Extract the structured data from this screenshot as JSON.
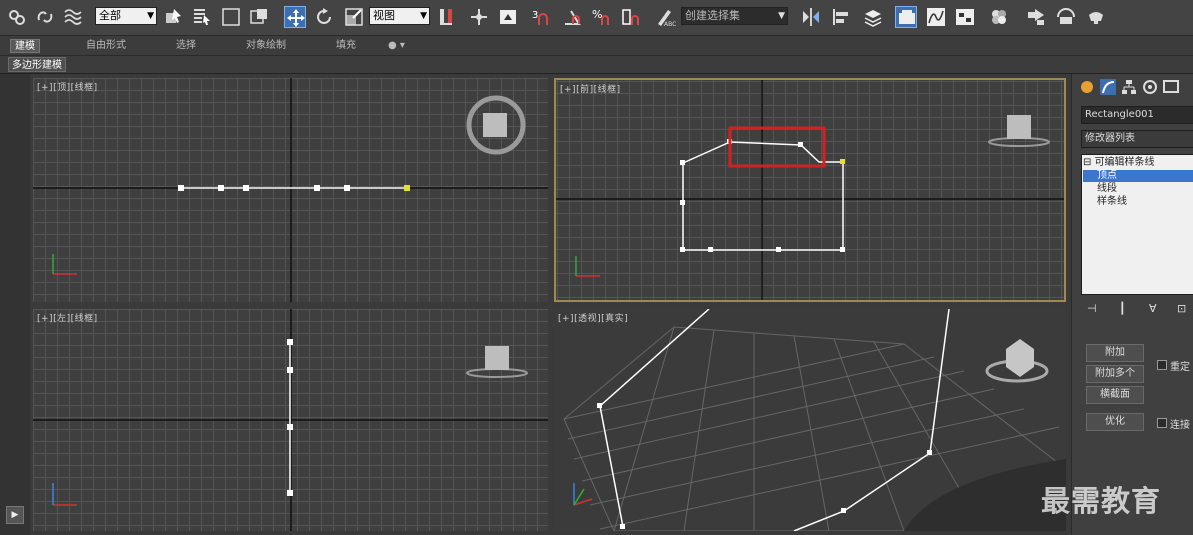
{
  "toolbar": {
    "selection_filter": "全部",
    "reference_coord": "视图",
    "named_selection_placeholder": "创建选择集",
    "snap_angle": "3",
    "icons": [
      "link-icon",
      "unlink-icon",
      "bind-spacewarp-icon",
      "select-object-icon",
      "select-by-name-icon",
      "rect-region-icon",
      "window-crossing-icon",
      "select-move-icon",
      "select-rotate-icon",
      "select-scale-icon",
      "pivot-icon",
      "select-manipulate-icon",
      "snap-toggle-icon",
      "angle-snap-icon",
      "percent-snap-icon",
      "spinner-snap-icon",
      "edit-named-sets-icon",
      "mirror-icon",
      "align-icon",
      "layer-manager-icon",
      "graphite-tools-icon",
      "curve-editor-icon",
      "schematic-view-icon",
      "material-editor-icon",
      "render-setup-icon",
      "rendered-frame-icon",
      "render-icon"
    ]
  },
  "ribbon": {
    "tabs": [
      "建模",
      "自由形式",
      "选择",
      "对象绘制",
      "填充"
    ],
    "subtab": "多边形建模"
  },
  "viewports": {
    "top": "[+][顶][线框]",
    "front": "[+][前][线框]",
    "left": "[+][左][线框]",
    "perspective": "[+][透视][真实]"
  },
  "command_panel": {
    "object_name": "Rectangle001",
    "modifier_list": "修改器列表",
    "stack": [
      {
        "label": "可编辑样条线",
        "level": 0,
        "selected": false
      },
      {
        "label": "顶点",
        "level": 1,
        "selected": true
      },
      {
        "label": "线段",
        "level": 1,
        "selected": false
      },
      {
        "label": "样条线",
        "level": 1,
        "selected": false
      }
    ],
    "attach": "附加",
    "attach_multiple": "附加多个",
    "cross_section": "横截面",
    "reorient": "重定",
    "refine": "优化",
    "connect": "连接"
  },
  "watermark": "最需教育",
  "colors": {
    "selection_highlight": "#d42020",
    "active_viewport_border": "#a08a50",
    "selected_vertex": "#e6e02a",
    "stack_selection": "#3a78d0"
  }
}
